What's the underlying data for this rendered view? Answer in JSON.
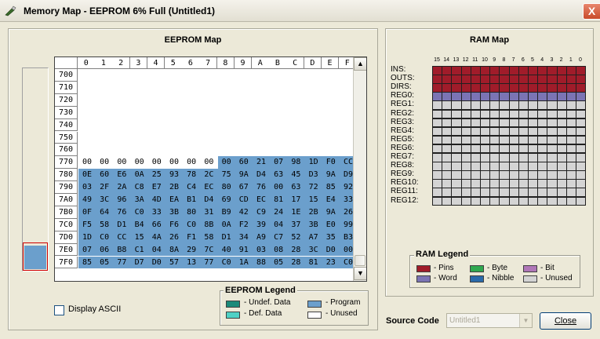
{
  "window": {
    "title": "Memory Map - EEPROM 6% Full (Untitled1)",
    "close_glyph": "X"
  },
  "eeprom": {
    "title": "EEPROM Map",
    "columns": [
      "0",
      "1",
      "2",
      "3",
      "4",
      "5",
      "6",
      "7",
      "8",
      "9",
      "A",
      "B",
      "C",
      "D",
      "E",
      "F"
    ],
    "rows": [
      {
        "addr": "700",
        "cells": []
      },
      {
        "addr": "710",
        "cells": []
      },
      {
        "addr": "720",
        "cells": []
      },
      {
        "addr": "730",
        "cells": []
      },
      {
        "addr": "740",
        "cells": []
      },
      {
        "addr": "750",
        "cells": []
      },
      {
        "addr": "760",
        "cells": []
      },
      {
        "addr": "770",
        "cells": [
          "00",
          "00",
          "00",
          "00",
          "00",
          "00",
          "00",
          "00",
          "00",
          "60",
          "21",
          "07",
          "98",
          "1D",
          "F0",
          "CC"
        ],
        "program_start": 8
      },
      {
        "addr": "780",
        "cells": [
          "0E",
          "60",
          "E6",
          "0A",
          "25",
          "93",
          "78",
          "2C",
          "75",
          "9A",
          "D4",
          "63",
          "45",
          "D3",
          "9A",
          "D9"
        ],
        "program_start": 0
      },
      {
        "addr": "790",
        "cells": [
          "03",
          "2F",
          "2A",
          "C8",
          "E7",
          "2B",
          "C4",
          "EC",
          "80",
          "67",
          "76",
          "00",
          "63",
          "72",
          "85",
          "92"
        ],
        "program_start": 0
      },
      {
        "addr": "7A0",
        "cells": [
          "49",
          "3C",
          "96",
          "3A",
          "4D",
          "EA",
          "B1",
          "D4",
          "69",
          "CD",
          "EC",
          "81",
          "17",
          "15",
          "E4",
          "33"
        ],
        "program_start": 0
      },
      {
        "addr": "7B0",
        "cells": [
          "0F",
          "64",
          "76",
          "C0",
          "33",
          "3B",
          "80",
          "31",
          "B9",
          "42",
          "C9",
          "24",
          "1E",
          "2B",
          "9A",
          "26"
        ],
        "program_start": 0
      },
      {
        "addr": "7C0",
        "cells": [
          "F5",
          "58",
          "D1",
          "B4",
          "66",
          "F6",
          "C0",
          "8B",
          "0A",
          "F2",
          "39",
          "04",
          "37",
          "3B",
          "E0",
          "99"
        ],
        "program_start": 0
      },
      {
        "addr": "7D0",
        "cells": [
          "1D",
          "C0",
          "CC",
          "15",
          "4A",
          "26",
          "F1",
          "58",
          "D1",
          "34",
          "A9",
          "C7",
          "52",
          "A7",
          "35",
          "B3"
        ],
        "program_start": 0
      },
      {
        "addr": "7E0",
        "cells": [
          "07",
          "06",
          "B8",
          "C1",
          "04",
          "8A",
          "29",
          "7C",
          "40",
          "91",
          "03",
          "08",
          "28",
          "3C",
          "D0",
          "00"
        ],
        "program_start": 0
      },
      {
        "addr": "7F0",
        "cells": [
          "85",
          "05",
          "77",
          "D7",
          "D0",
          "57",
          "13",
          "77",
          "C0",
          "1A",
          "88",
          "05",
          "28",
          "81",
          "23",
          "C0"
        ],
        "program_start": 0
      }
    ],
    "scroll_up": "▲",
    "scroll_down": "▼",
    "legend": {
      "title": "EEPROM Legend",
      "items": [
        {
          "label": "- Undef. Data",
          "color": "#1a8a7a"
        },
        {
          "label": "- Program",
          "color": "#6b9fcc"
        },
        {
          "label": "- Def. Data",
          "color": "#4fd1c5"
        },
        {
          "label": "- Unused",
          "color": "#ffffff"
        }
      ]
    },
    "display_ascii_label": "Display ASCII",
    "display_ascii_checked": false,
    "overview_fill_fraction": 0.06
  },
  "ram": {
    "title": "RAM Map",
    "bit_numbers": [
      "15",
      "14",
      "13",
      "12",
      "11",
      "10",
      "9",
      "8",
      "7",
      "6",
      "5",
      "4",
      "3",
      "2",
      "1",
      "0"
    ],
    "registers": [
      {
        "label": "INS:",
        "type": "pins"
      },
      {
        "label": "OUTS:",
        "type": "pins"
      },
      {
        "label": "DIRS:",
        "type": "pins"
      },
      {
        "label": "REG0:",
        "type": "word"
      },
      {
        "label": "REG1:",
        "type": "unused"
      },
      {
        "label": "REG2:",
        "type": "unused"
      },
      {
        "label": "REG3:",
        "type": "unused"
      },
      {
        "label": "REG4:",
        "type": "unused"
      },
      {
        "label": "REG5:",
        "type": "unused"
      },
      {
        "label": "REG6:",
        "type": "unused"
      },
      {
        "label": "REG7:",
        "type": "unused"
      },
      {
        "label": "REG8:",
        "type": "unused"
      },
      {
        "label": "REG9:",
        "type": "unused"
      },
      {
        "label": "REG10:",
        "type": "unused"
      },
      {
        "label": "REG11:",
        "type": "unused"
      },
      {
        "label": "REG12:",
        "type": "unused"
      }
    ],
    "legend": {
      "title": "RAM Legend",
      "items": [
        {
          "label": "- Pins",
          "color": "#a01c2a"
        },
        {
          "label": "- Byte",
          "color": "#2fa84f"
        },
        {
          "label": "- Bit",
          "color": "#b077b8"
        },
        {
          "label": "- Word",
          "color": "#7b74b4"
        },
        {
          "label": "- Nibble",
          "color": "#2a6aaa"
        },
        {
          "label": "- Unused",
          "color": "#d4d4d4"
        }
      ]
    }
  },
  "footer": {
    "source_code_label": "Source Code",
    "source_code_value": "Untitled1",
    "close_label": "Close"
  }
}
